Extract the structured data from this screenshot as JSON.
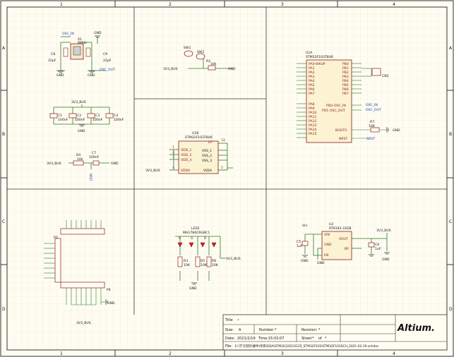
{
  "frame": {
    "columns": [
      "1",
      "2",
      "3",
      "4"
    ],
    "rows": [
      "A",
      "B",
      "C",
      "D"
    ]
  },
  "crystal": {
    "ref": "X1",
    "part": "8MHz",
    "net_in": "OSC_IN",
    "net_out": "OSC_OUT",
    "gnd_top": "GND",
    "gnd1": "GND",
    "gnd2": "GND",
    "c8_ref": "C8",
    "c8_val": "22pF",
    "c9_ref": "C9",
    "c9_val": "22pF"
  },
  "decoupling": {
    "net": "3V3_BUS",
    "gnd": "GND",
    "caps": [
      {
        "ref": "C1",
        "val": "100nF"
      },
      {
        "ref": "C2",
        "val": "100nF"
      },
      {
        "ref": "C3",
        "val": "100nF"
      },
      {
        "ref": "C4",
        "val": "100nF"
      }
    ]
  },
  "reset": {
    "net": "3V3_BUS",
    "r_ref": "R4",
    "r_val": "10k",
    "c_ref": "C7",
    "c_val": "100nF",
    "nrst": "NRST",
    "gnd": "GND"
  },
  "button": {
    "sw1": "SW1",
    "sw2": "SW2",
    "r_ref": "R2",
    "r_val": "10k",
    "net": "3V3_BUS",
    "gnd": "GND"
  },
  "mcu_power": {
    "ref": "U1B",
    "part": "STM32F103T8U6",
    "pins_left": [
      {
        "num": "1",
        "name": "VDD_1"
      },
      {
        "num": "2",
        "name": "VDD_2"
      },
      {
        "num": "3",
        "name": "VDD_3"
      },
      {
        "num": "4",
        "name": "VDDA"
      }
    ],
    "pins_right": [
      {
        "num": "33",
        "name": "EP"
      },
      {
        "num": "",
        "name": "VSS_1"
      },
      {
        "num": "",
        "name": "VSS_2"
      },
      {
        "num": "",
        "name": "VSS_3"
      },
      {
        "num": "5",
        "name": "VSSA"
      }
    ],
    "net": "3V3_BUS"
  },
  "mcu": {
    "ref": "U1A",
    "part": "STM32F103T8U6",
    "pins_left": [
      "PA0-WKUP",
      "PA1",
      "PA2",
      "PA3",
      "PA4",
      "PA5",
      "PA6",
      "PA7",
      "",
      "PA8",
      "PA9",
      "PA10",
      "PA11",
      "PA12",
      "PA13",
      "PA14",
      "PA15"
    ],
    "pins_right_top": [
      "PB0",
      "PB1",
      "PB2",
      "PB3",
      "PB4",
      "PB5",
      "PB6",
      "PB7"
    ],
    "pins_right_mid": [
      "PD0-OSC_IN",
      "PD1-OSC_OUT"
    ],
    "boot": "BOOT0",
    "nrst": "NRST",
    "net_osc_in": "OSC_IN",
    "net_osc_out": "OSC_OUT",
    "cn2": "CN2",
    "r_ref": "R7",
    "r_val": "10K",
    "gnd": "GND",
    "nrst_net": "NRST"
  },
  "header": {
    "j_top": "P3",
    "j_bot": "P4",
    "net": "3V3_BUS",
    "gnd": "GND"
  },
  "leds": {
    "ref": "LED1",
    "part": "MH1784CRGBC1",
    "colors": [
      "R",
      "G",
      "B"
    ],
    "resistors": [
      {
        "ref": "R3",
        "val": "10K"
      },
      {
        "ref": "R5",
        "val": "10K"
      },
      {
        "ref": "R6",
        "val": "10K"
      }
    ],
    "net": "3V3_BUS",
    "gnd": "GND"
  },
  "regulator": {
    "ref": "U2",
    "part": "RT9193-33GB",
    "vin_net": "Vin",
    "out_net": "3V3_BUS",
    "pins": [
      "VIN",
      "VOUT",
      "GND",
      "BP",
      "EN"
    ],
    "c5_ref": "C5",
    "c5_val": "1uF",
    "c6_ref": "C6",
    "c6_val": "1uF",
    "gnd1": "GND",
    "gnd2": "GND",
    "gnd3": "GND"
  },
  "titleblock": {
    "title_label": "Title",
    "title_value": "*",
    "size_label": "Size:",
    "size_value": "A",
    "number_label": "Number:",
    "number_value": "*",
    "revision_label": "Revision:",
    "revision_value": "*",
    "date_label": "Date:",
    "date_value": "2021/2/19",
    "time_label": "Time:",
    "time_value": "15:02:07",
    "sheet_label": "Sheet",
    "sheet_value": "*",
    "of_label": "of",
    "of_value": "*",
    "file_label": "File:",
    "file_value": "E:\\学习资料\\硬件\\项目\\EDA\\STM32\\20210125_STM32F103\\STM32F103SCH_2021-02-19.schdoc",
    "logo": "Altium."
  }
}
